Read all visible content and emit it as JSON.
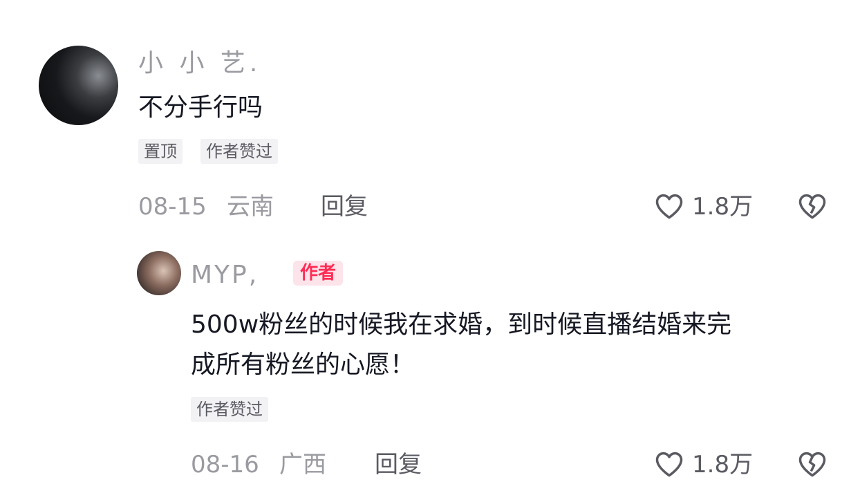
{
  "comment": {
    "username": "小 小 艺.",
    "text": "不分手行吗",
    "tags": [
      "置顶",
      "作者赞过"
    ],
    "date": "08-15",
    "location": "云南",
    "reply_label": "回复",
    "likes": "1.8万"
  },
  "reply": {
    "username": "MYP,",
    "author_badge": "作者",
    "text_line1": "500w粉丝的时候我在求婚，到时候直播结婚来完",
    "text_line2": "成所有粉丝的心愿！",
    "tag": "作者赞过",
    "date": "08-16",
    "location": "广西",
    "reply_label": "回复",
    "likes": "1.8万"
  },
  "icons": {
    "like": "heart-outline-icon",
    "dislike": "broken-heart-icon"
  }
}
